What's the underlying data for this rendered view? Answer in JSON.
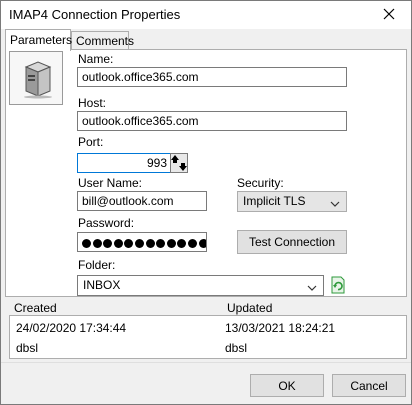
{
  "window": {
    "title": "IMAP4 Connection Properties"
  },
  "tabs": [
    {
      "label": "Parameters"
    },
    {
      "label": "Comments"
    }
  ],
  "form": {
    "name_label": "Name:",
    "name_value": "outlook.office365.com",
    "host_label": "Host:",
    "host_value": "outlook.office365.com",
    "port_label": "Port:",
    "port_value": "993",
    "username_label": "User Name:",
    "username_value": "bill@outlook.com",
    "password_label": "Password:",
    "password_dots": 13,
    "security_label": "Security:",
    "security_value": "Implicit TLS",
    "folder_label": "Folder:",
    "folder_value": "INBOX"
  },
  "buttons": {
    "test_connection": "Test Connection",
    "ok": "OK",
    "cancel": "Cancel"
  },
  "info": {
    "created_label": "Created",
    "updated_label": "Updated",
    "created_date": "24/02/2020 17:34:44",
    "updated_date": "13/03/2021 18:24:21",
    "created_by": "dbsl",
    "updated_by": "dbsl"
  },
  "icons": {
    "server": "server-icon",
    "close": "close-icon",
    "spin": "spin-arrows-icon",
    "chevron": "chevron-down-icon",
    "refresh": "refresh-icon"
  },
  "colors": {
    "focus_border": "#0078d7",
    "refresh_green": "#2e9a3b"
  }
}
